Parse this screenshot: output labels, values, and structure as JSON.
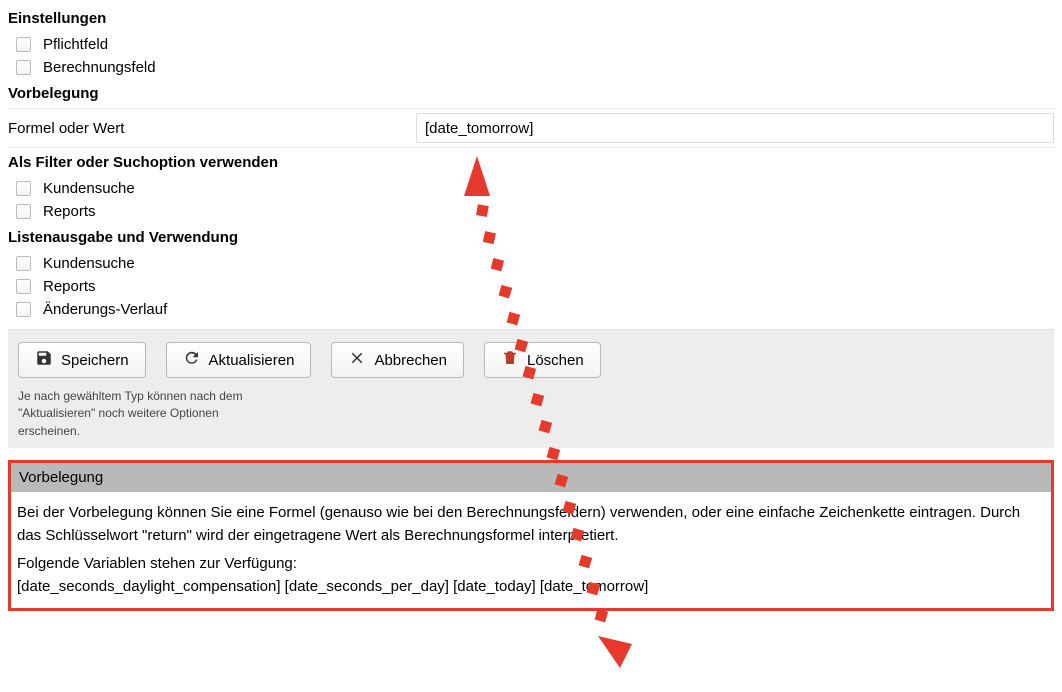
{
  "sections": {
    "settings": {
      "heading": "Einstellungen",
      "items": [
        "Pflichtfeld",
        "Berechnungsfeld"
      ]
    },
    "prefill": {
      "heading": "Vorbelegung",
      "field_label": "Formel oder Wert",
      "field_value": "[date_tomorrow]"
    },
    "filter": {
      "heading": "Als Filter oder Suchoption verwenden",
      "items": [
        "Kundensuche",
        "Reports"
      ]
    },
    "listout": {
      "heading": "Listenausgabe und Verwendung",
      "items": [
        "Kundensuche",
        "Reports",
        "Änderungs-Verlauf"
      ]
    }
  },
  "buttons": {
    "save": "Speichern",
    "refresh": "Aktualisieren",
    "cancel": "Abbrechen",
    "delete": "Löschen"
  },
  "hint": "Je nach gewähltem Typ können nach dem \"Aktualisieren\" noch weitere Optionen erscheinen.",
  "help": {
    "title": "Vorbelegung",
    "p1": "Bei der Vorbelegung können Sie eine Formel (genauso wie bei den Berechnungsfeldern) verwenden, oder eine einfache Zeichenkette eintragen. Durch das Schlüsselwort \"return\" wird der eingetragene Wert als Berechnungsformel interpretiert.",
    "p2": "Folgende Variablen stehen zur Verfügung:",
    "vars": "[date_seconds_daylight_compensation] [date_seconds_per_day] [date_today] [date_tomorrow]"
  },
  "annotation": {
    "color": "#e53a2b",
    "pattern": "dotted-arrow"
  }
}
